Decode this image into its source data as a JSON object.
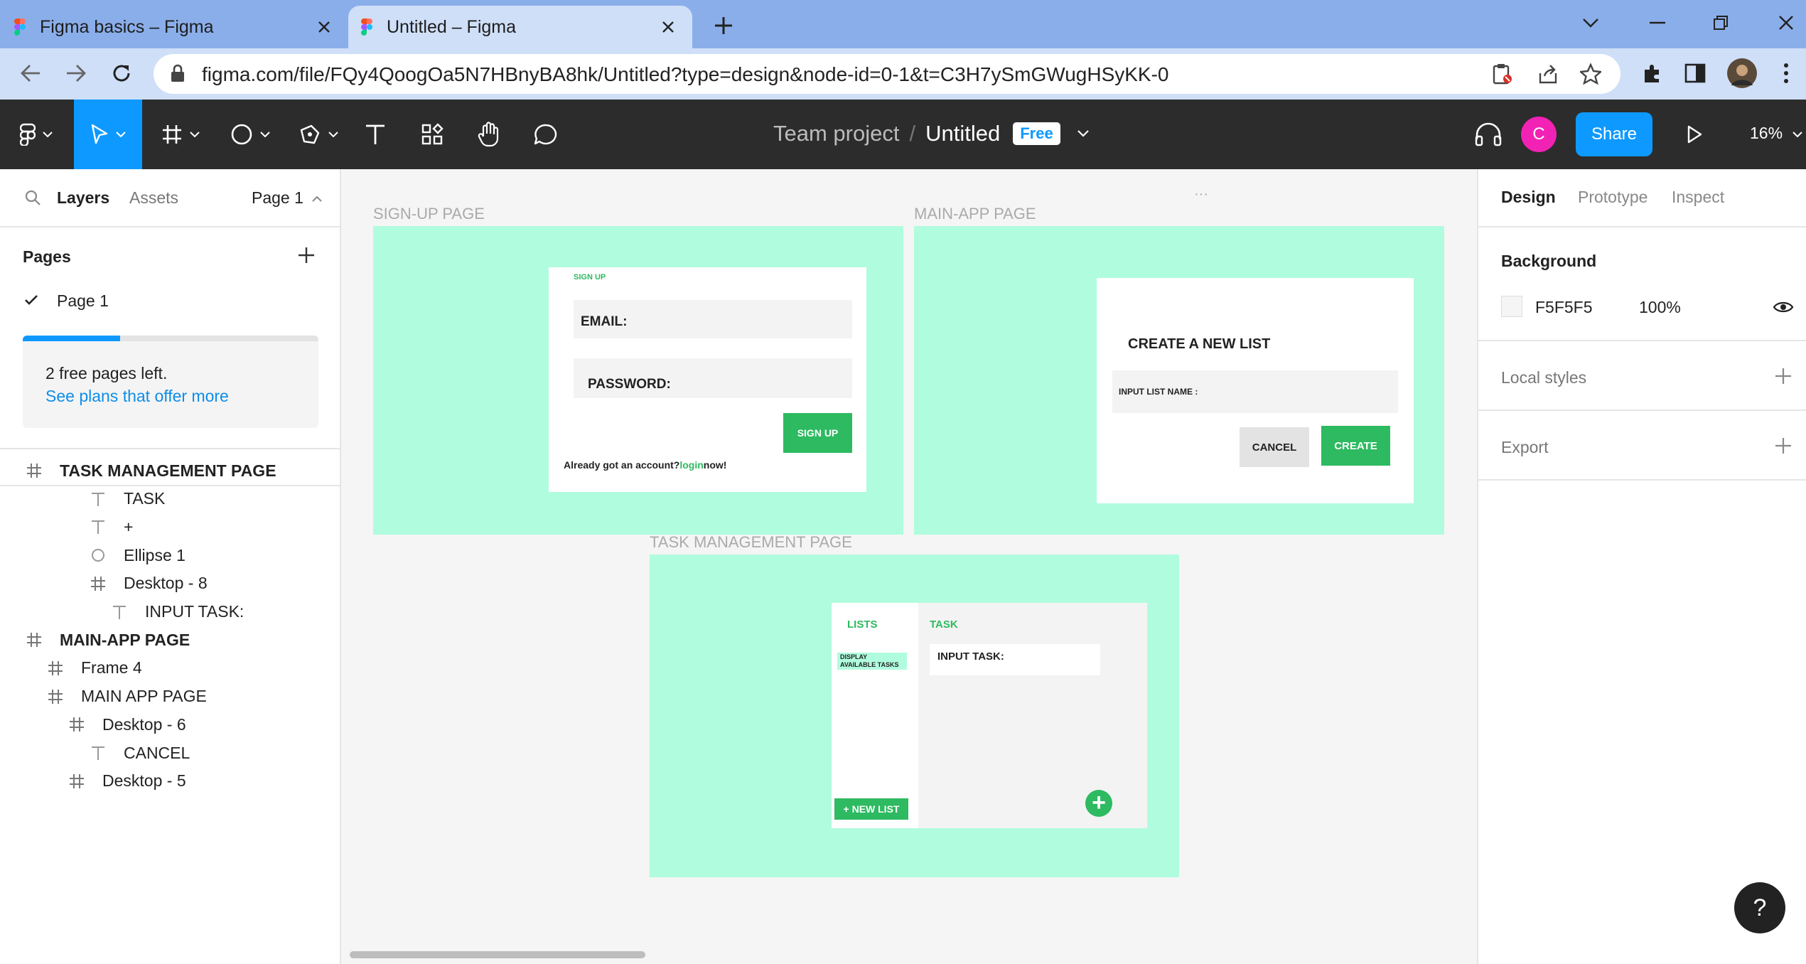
{
  "browser": {
    "tabs": [
      {
        "title": "Figma basics – Figma",
        "active": false
      },
      {
        "title": "Untitled – Figma",
        "active": true
      }
    ],
    "url": "figma.com/file/FQy4QoogOa5N7HBnyBA8hk/Untitled?type=design&node-id=0-1&t=C3H7ySmGWugHSyKK-0"
  },
  "figma": {
    "team": "Team project",
    "separator": "/",
    "file_name": "Untitled",
    "plan_badge": "Free",
    "avatar_initial": "C",
    "share_label": "Share",
    "zoom": "16%",
    "colors": {
      "toolbar": "#2c2c2c",
      "accent": "#0d99ff",
      "avatar": "#f222b5"
    }
  },
  "left_panel": {
    "tabs": [
      "Layers",
      "Assets"
    ],
    "page_selector": "Page 1",
    "pages_heading": "Pages",
    "pages": [
      "Page 1"
    ],
    "free_notice": {
      "text": "2 free pages left.",
      "link": "See plans that offer more",
      "progress": 0.33
    },
    "layers": [
      {
        "name": "TASK MANAGEMENT PAGE",
        "icon": "frame-icon",
        "level": 0,
        "bold": true
      },
      {
        "name": "TASK",
        "icon": "text-icon",
        "level": 3
      },
      {
        "name": "+",
        "icon": "text-icon",
        "level": 3
      },
      {
        "name": "Ellipse 1",
        "icon": "ellipse-icon",
        "level": 3
      },
      {
        "name": "Desktop - 8",
        "icon": "frame-icon",
        "level": 3
      },
      {
        "name": "INPUT TASK:",
        "icon": "text-icon",
        "level": 4
      },
      {
        "name": "MAIN-APP PAGE",
        "icon": "frame-icon",
        "level": 0,
        "bold": true
      },
      {
        "name": "Frame 4",
        "icon": "frame-icon",
        "level": 1
      },
      {
        "name": "MAIN APP PAGE",
        "icon": "frame-icon",
        "level": 1
      },
      {
        "name": "Desktop - 6",
        "icon": "frame-icon",
        "level": 2
      },
      {
        "name": "CANCEL",
        "icon": "text-icon",
        "level": 3
      },
      {
        "name": "Desktop - 5",
        "icon": "frame-icon",
        "level": 2
      }
    ]
  },
  "right_panel": {
    "tabs": [
      "Design",
      "Prototype",
      "Inspect"
    ],
    "background_heading": "Background",
    "background_hex": "F5F5F5",
    "background_opacity": "100%",
    "local_styles": "Local styles",
    "export": "Export"
  },
  "canvas": {
    "ellipsis": "···",
    "signup": {
      "frame_label": "SIGN-UP PAGE",
      "heading": "SIGN UP",
      "email_label": "EMAIL:",
      "password_label": "PASSWORD:",
      "button": "SIGN UP",
      "footer_prefix": "Already got an account?",
      "footer_link": "login",
      "footer_suffix": "now!"
    },
    "mainapp": {
      "frame_label": "MAIN-APP PAGE",
      "title": "CREATE A NEW LIST",
      "input_label": "INPUT LIST NAME :",
      "cancel": "CANCEL",
      "create": "CREATE"
    },
    "task": {
      "frame_label": "TASK MANAGEMENT PAGE",
      "lists_heading": "LISTS",
      "display_tasks": "DISPLAY AVAILABLE TASKS",
      "task_heading": "TASK",
      "input_task": "INPUT TASK:",
      "new_list": "+ NEW LIST",
      "add_symbol": "+"
    },
    "colors": {
      "frame_bg": "#b0fcde",
      "green": "#2dba60",
      "input_bg": "#f3f3f3"
    }
  },
  "help": "?"
}
